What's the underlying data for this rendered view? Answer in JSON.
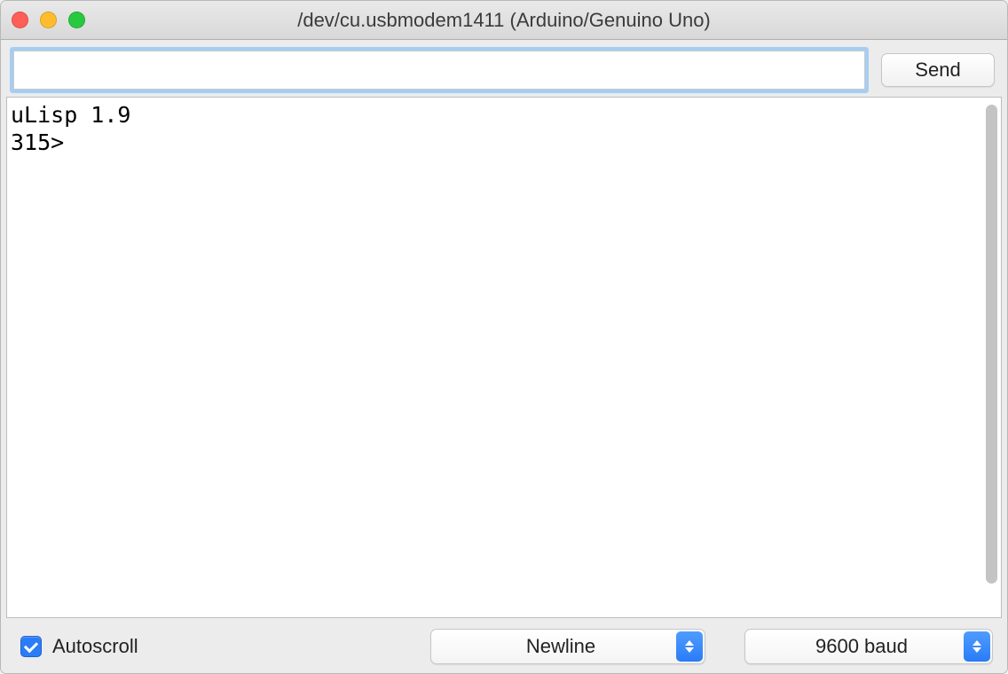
{
  "window": {
    "title": "/dev/cu.usbmodem1411 (Arduino/Genuino Uno)"
  },
  "input_row": {
    "input_value": "",
    "send_label": "Send"
  },
  "output": {
    "text": "uLisp 1.9\n315> "
  },
  "bottom": {
    "autoscroll_label": "Autoscroll",
    "autoscroll_checked": true,
    "line_ending_selected": "Newline",
    "baud_selected": "9600 baud"
  }
}
